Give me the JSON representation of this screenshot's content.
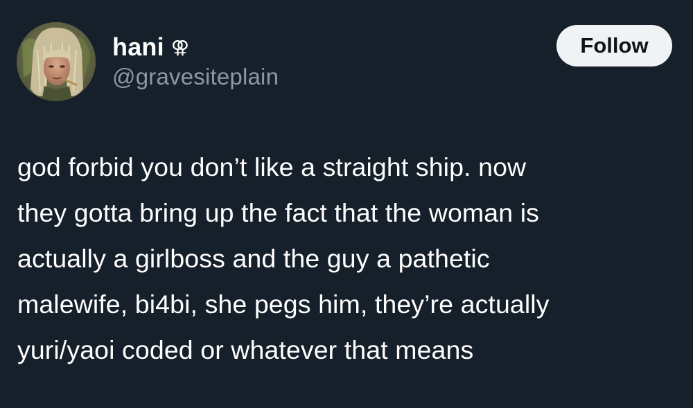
{
  "user": {
    "display_name": "hani",
    "name_symbol": "⚢",
    "handle": "@gravesiteplain"
  },
  "actions": {
    "follow_label": "Follow"
  },
  "tweet": {
    "lines": [
      "god forbid you don’t like a straight ship. now",
      "they gotta bring up the fact that the woman is",
      "actually a girlboss and the guy a pathetic",
      "malewife, bi4bi, she pegs him, they’re actually",
      "yuri/yaoi coded or whatever that means"
    ]
  },
  "colors": {
    "background": "#15202b",
    "primary_text": "#ffffff",
    "secondary_text": "#8b98a5",
    "button_bg": "#eff3f4",
    "button_text": "#0f1419"
  }
}
